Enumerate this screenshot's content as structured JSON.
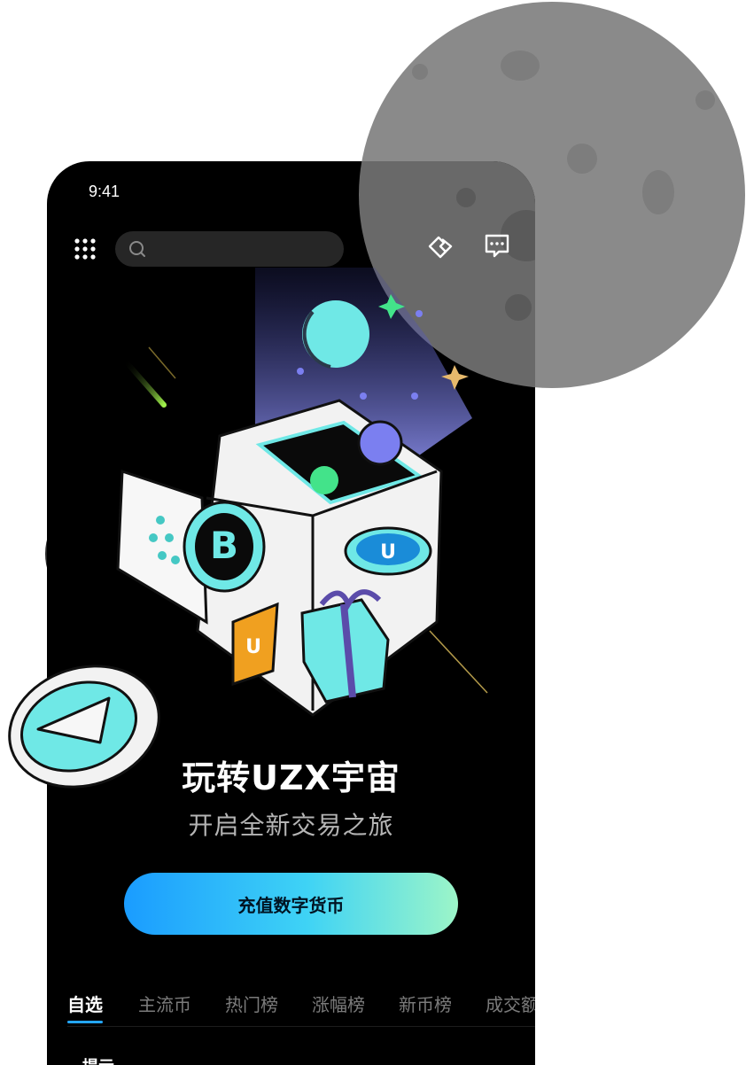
{
  "status_bar": {
    "time": "9:41"
  },
  "header": {
    "search": {
      "placeholder": ""
    },
    "icons": [
      "menu-grid-icon",
      "search-icon",
      "handshake-icon",
      "message-icon"
    ]
  },
  "hero": {
    "title": "玩转UZX宇宙",
    "subtitle": "开启全新交易之旅",
    "cta_label": "充值数字货币"
  },
  "tabs": [
    {
      "label": "自选",
      "active": true
    },
    {
      "label": "主流币",
      "active": false
    },
    {
      "label": "热门榜",
      "active": false
    },
    {
      "label": "涨幅榜",
      "active": false
    },
    {
      "label": "新币榜",
      "active": false
    },
    {
      "label": "成交额",
      "active": false
    }
  ],
  "list_preview": {
    "partial_text": "提示"
  },
  "colors": {
    "background": "#000000",
    "cta_gradient_start": "#1a9cff",
    "cta_gradient_end": "#9cf5c8",
    "tab_active_underline": "#24a6ff",
    "moon": "#8a8a8a"
  }
}
